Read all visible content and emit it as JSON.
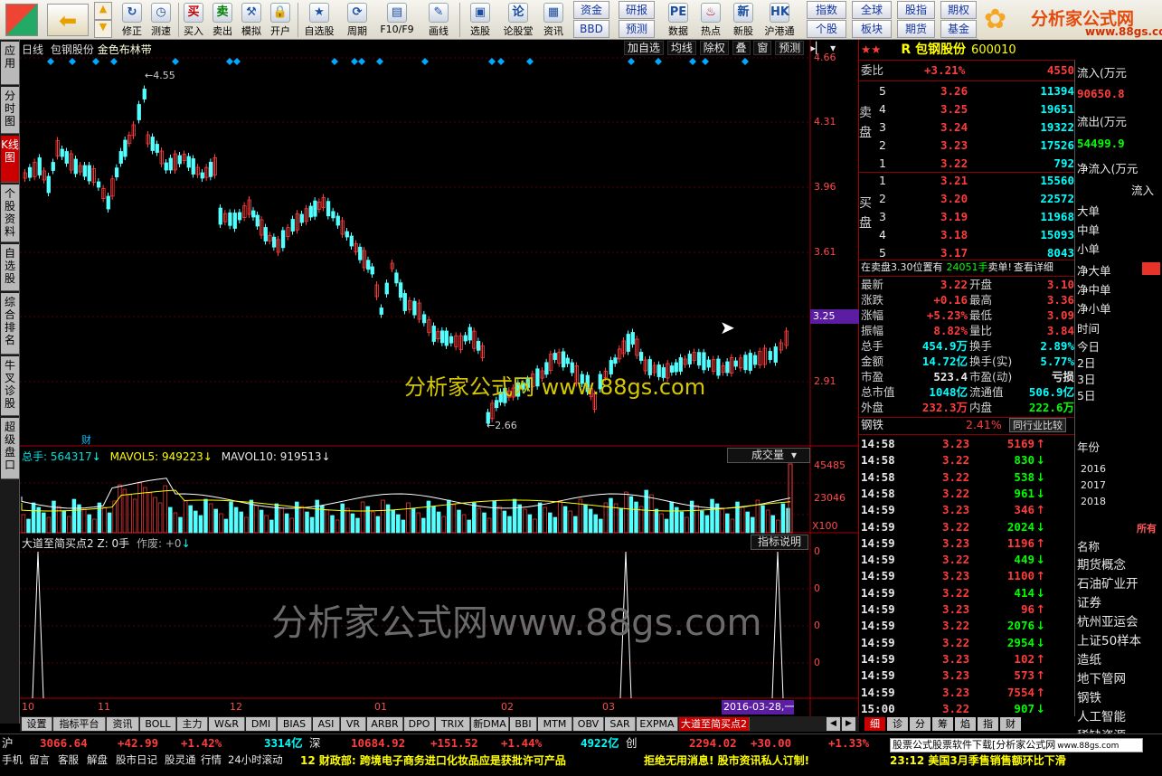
{
  "toolbar": {
    "items": [
      "修正",
      "测速",
      "买入",
      "卖出",
      "模拟",
      "开户",
      "自选股",
      "周期",
      "F10/F9",
      "画线",
      "选股",
      "论股堂",
      "资讯",
      "数据",
      "热点",
      "新股",
      "沪港通"
    ],
    "buttons": [
      "资金",
      "研报",
      "BBD",
      "预测",
      "指数",
      "全球",
      "股指",
      "期权",
      "个股",
      "板块",
      "期货",
      "基金"
    ],
    "logo_text": "分析家公式网",
    "logo_url": "www.88gs.com"
  },
  "lefttabs": [
    "应用",
    "分时图",
    "K线图",
    "个股资料",
    "自选股",
    "综合排名",
    "牛叉诊股",
    "超级盘口"
  ],
  "chart": {
    "header": {
      "period": "日线",
      "name": "包钢股份",
      "indicator": "金色布林带"
    },
    "controls": [
      "加自选",
      "均线",
      "除权",
      "叠",
      "窗",
      "预测"
    ],
    "price_axis": [
      "4.66",
      "4.31",
      "3.96",
      "3.61",
      "3.25",
      "2.91"
    ],
    "current_price_label": "3.25",
    "high_label": "4.55",
    "low_label": "2.66",
    "cai_label": "财",
    "watermark": "分析家公式网 www.88gs.com",
    "watermark2": "分析家公式网www.88gs.com",
    "vol_header": {
      "total": "总手: 564317",
      "ma5": "MAVOL5: 949223",
      "ma10": "MAVOL10: 919513"
    },
    "vol_dropdown": "成交量",
    "vol_axis": [
      "45485",
      "23046",
      "X100"
    ],
    "ind_header": {
      "name": "大道至简买点2",
      "z": "Z: 0手",
      "fail": "作废: +0"
    },
    "ind_button": "指标说明",
    "ind_axis": [
      "0",
      "0",
      "0",
      "0"
    ],
    "dates": [
      "10",
      "11",
      "12",
      "01",
      "02",
      "03"
    ],
    "date_highlight": "2016-03-28,一"
  },
  "bottom_tabs": [
    "设置",
    "指标平台",
    "资讯",
    "BOLL",
    "主力",
    "W&R",
    "DMI",
    "BIAS",
    "ASI",
    "VR",
    "ARBR",
    "DPO",
    "TRIX",
    "新DMA",
    "BBI",
    "MTM",
    "OBV",
    "SAR",
    "EXPMA",
    "大道至简买点2"
  ],
  "side": {
    "title": "R 包钢股份",
    "code": "600010",
    "weibi": {
      "label": "委比",
      "pct": "+3.21%",
      "val": "4550"
    },
    "sell": [
      {
        "n": "5",
        "p": "3.26",
        "v": "11394"
      },
      {
        "n": "4",
        "p": "3.25",
        "v": "19651"
      },
      {
        "n": "3",
        "p": "3.24",
        "v": "19322"
      },
      {
        "n": "2",
        "p": "3.23",
        "v": "17526"
      },
      {
        "n": "1",
        "p": "3.22",
        "v": "792"
      }
    ],
    "buy": [
      {
        "n": "1",
        "p": "3.21",
        "v": "15560"
      },
      {
        "n": "2",
        "p": "3.20",
        "v": "22572"
      },
      {
        "n": "3",
        "p": "3.19",
        "v": "11968"
      },
      {
        "n": "4",
        "p": "3.18",
        "v": "15093"
      },
      {
        "n": "5",
        "p": "3.17",
        "v": "8043"
      }
    ],
    "sell_label": "卖盘",
    "buy_label": "买盘",
    "notice": {
      "a": "在卖盘3.30位置有",
      "b": "24051手",
      "c": "卖单!",
      "d": "查看详细"
    },
    "stats": [
      {
        "l1": "最新",
        "v1": "3.22",
        "l2": "开盘",
        "v2": "3.10"
      },
      {
        "l1": "涨跌",
        "v1": "+0.16",
        "l2": "最高",
        "v2": "3.36"
      },
      {
        "l1": "涨幅",
        "v1": "+5.23%",
        "l2": "最低",
        "v2": "3.09"
      },
      {
        "l1": "振幅",
        "v1": "8.82%",
        "l2": "量比",
        "v2": "3.84"
      },
      {
        "l1": "总手",
        "v1": "454.9万",
        "l2": "换手",
        "v2": "2.89%"
      },
      {
        "l1": "金额",
        "v1": "14.72亿",
        "l2": "换手(实)",
        "v2": "5.77%"
      },
      {
        "l1": "市盈",
        "v1": "523.4",
        "l2": "市盈(动)",
        "v2": "亏损"
      },
      {
        "l1": "总市值",
        "v1": "1048亿",
        "l2": "流通值",
        "v2": "506.9亿"
      },
      {
        "l1": "外盘",
        "v1": "232.3万",
        "l2": "内盘",
        "v2": "222.6万"
      }
    ],
    "industry": {
      "name": "钢铁",
      "pct": "2.41%",
      "btn": "同行业比较"
    },
    "ticks": [
      {
        "t": "14:58",
        "p": "3.23",
        "v": "5169",
        "d": "up"
      },
      {
        "t": "14:58",
        "p": "3.22",
        "v": "830",
        "d": "dn"
      },
      {
        "t": "14:58",
        "p": "3.22",
        "v": "538",
        "d": "dn"
      },
      {
        "t": "14:58",
        "p": "3.22",
        "v": "961",
        "d": "dn"
      },
      {
        "t": "14:59",
        "p": "3.23",
        "v": "346",
        "d": "up"
      },
      {
        "t": "14:59",
        "p": "3.22",
        "v": "2024",
        "d": "dn"
      },
      {
        "t": "14:59",
        "p": "3.23",
        "v": "1196",
        "d": "up"
      },
      {
        "t": "14:59",
        "p": "3.22",
        "v": "449",
        "d": "dn"
      },
      {
        "t": "14:59",
        "p": "3.23",
        "v": "1100",
        "d": "up"
      },
      {
        "t": "14:59",
        "p": "3.22",
        "v": "414",
        "d": "dn"
      },
      {
        "t": "14:59",
        "p": "3.23",
        "v": "96",
        "d": "up"
      },
      {
        "t": "14:59",
        "p": "3.22",
        "v": "2076",
        "d": "dn"
      },
      {
        "t": "14:59",
        "p": "3.22",
        "v": "2954",
        "d": "dn"
      },
      {
        "t": "14:59",
        "p": "3.23",
        "v": "102",
        "d": "up"
      },
      {
        "t": "14:59",
        "p": "3.23",
        "v": "573",
        "d": "up"
      },
      {
        "t": "14:59",
        "p": "3.23",
        "v": "7554",
        "d": "up"
      },
      {
        "t": "15:00",
        "p": "3.22",
        "v": "907",
        "d": "dn"
      }
    ],
    "tick_tabs": [
      "细",
      "诊",
      "分",
      "筹",
      "焰",
      "指",
      "财"
    ],
    "flow": {
      "in_label": "流入(万元",
      "in_val": "90650.8",
      "out_label": "流出(万元",
      "out_val": "54499.9",
      "net_label": "净流入(万元",
      "col": "流入",
      "rows": [
        "大单",
        "中单",
        "小单"
      ],
      "net_rows": [
        "净大单",
        "净中单",
        "净小单"
      ]
    },
    "time": {
      "label": "时间",
      "rows": [
        "今日",
        "2日",
        "3日",
        "5日"
      ]
    },
    "year": {
      "label": "年份",
      "rows": [
        "2016",
        "2017",
        "2018"
      ],
      "right": "所有"
    },
    "concepts": {
      "label": "名称",
      "rows": [
        "期货概念",
        "石油矿业开",
        "证券",
        "杭州亚运会",
        "上证50样本",
        "造纸",
        "地下管网",
        "钢铁",
        "人工智能",
        "稀缺资源"
      ]
    }
  },
  "status": {
    "sh_label": "沪",
    "sh_val": "3066.64",
    "sh_chg": "+42.99",
    "sh_pct": "+1.42%",
    "sh_amt": "3314亿",
    "sz_label": "深",
    "sz_val": "10684.92",
    "sz_chg": "+151.52",
    "sz_pct": "+1.44%",
    "sz_amt": "4922亿",
    "cy_label": "创",
    "cy_val": "2294.02",
    "cy_chg": "+30.00",
    "cy_pct": "+1.33%",
    "bottom_items": [
      "手机",
      "留言",
      "客服",
      "解盘",
      "股市日记",
      "股灵通",
      "行情",
      "24小时滚动"
    ],
    "news": "12 财政部: 跨境电子商务进口化妆品应是获批许可产品",
    "news2": "拒绝无用消息! 股市资讯私人订制!",
    "right_link": "股票公式股票软件下载[分析家公式网",
    "right_url": "www.88gs.com",
    "ticker": "23:12 美国3月季售销售额环比下滑"
  }
}
